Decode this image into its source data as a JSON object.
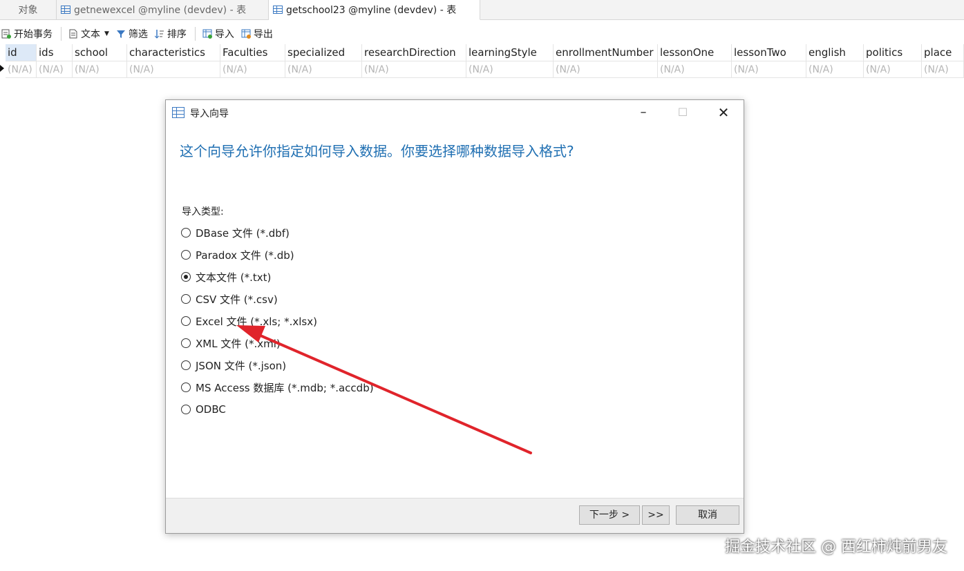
{
  "tabs": [
    {
      "label": "对象"
    },
    {
      "label": "getnewexcel @myline (devdev) - 表"
    },
    {
      "label": "getschool23 @myline (devdev) - 表"
    }
  ],
  "toolbar": {
    "begin_txn": "开始事务",
    "text": "文本",
    "filter": "筛选",
    "sort": "排序",
    "import": "导入",
    "export": "导出"
  },
  "grid": {
    "columns": [
      "id",
      "ids",
      "school",
      "characteristics",
      "Faculties",
      "specialized",
      "researchDirection",
      "learningStyle",
      "enrollmentNumber",
      "lessonOne",
      "lessonTwo",
      "english",
      "politics",
      "place"
    ],
    "null_value": "(N/A)"
  },
  "dialog": {
    "title": "导入向导",
    "heading": "这个向导允许你指定如何导入数据。你要选择哪种数据导入格式?",
    "group_label": "导入类型:",
    "options": [
      {
        "label": "DBase 文件 (*.dbf)",
        "selected": false
      },
      {
        "label": "Paradox 文件 (*.db)",
        "selected": false
      },
      {
        "label": "文本文件 (*.txt)",
        "selected": true
      },
      {
        "label": "CSV 文件 (*.csv)",
        "selected": false
      },
      {
        "label": "Excel 文件 (*.xls; *.xlsx)",
        "selected": false
      },
      {
        "label": "XML 文件 (*.xml)",
        "selected": false
      },
      {
        "label": "JSON 文件 (*.json)",
        "selected": false
      },
      {
        "label": "MS Access 数据库 (*.mdb; *.accdb)",
        "selected": false
      },
      {
        "label": "ODBC",
        "selected": false
      }
    ],
    "buttons": {
      "next": "下一步 >",
      "last": ">>",
      "cancel": "取消"
    }
  },
  "watermark": "掘金技术社区 @ 西红柿炖前男友",
  "colors": {
    "accent": "#1f6fb2",
    "annotation_arrow": "#e0242b"
  }
}
